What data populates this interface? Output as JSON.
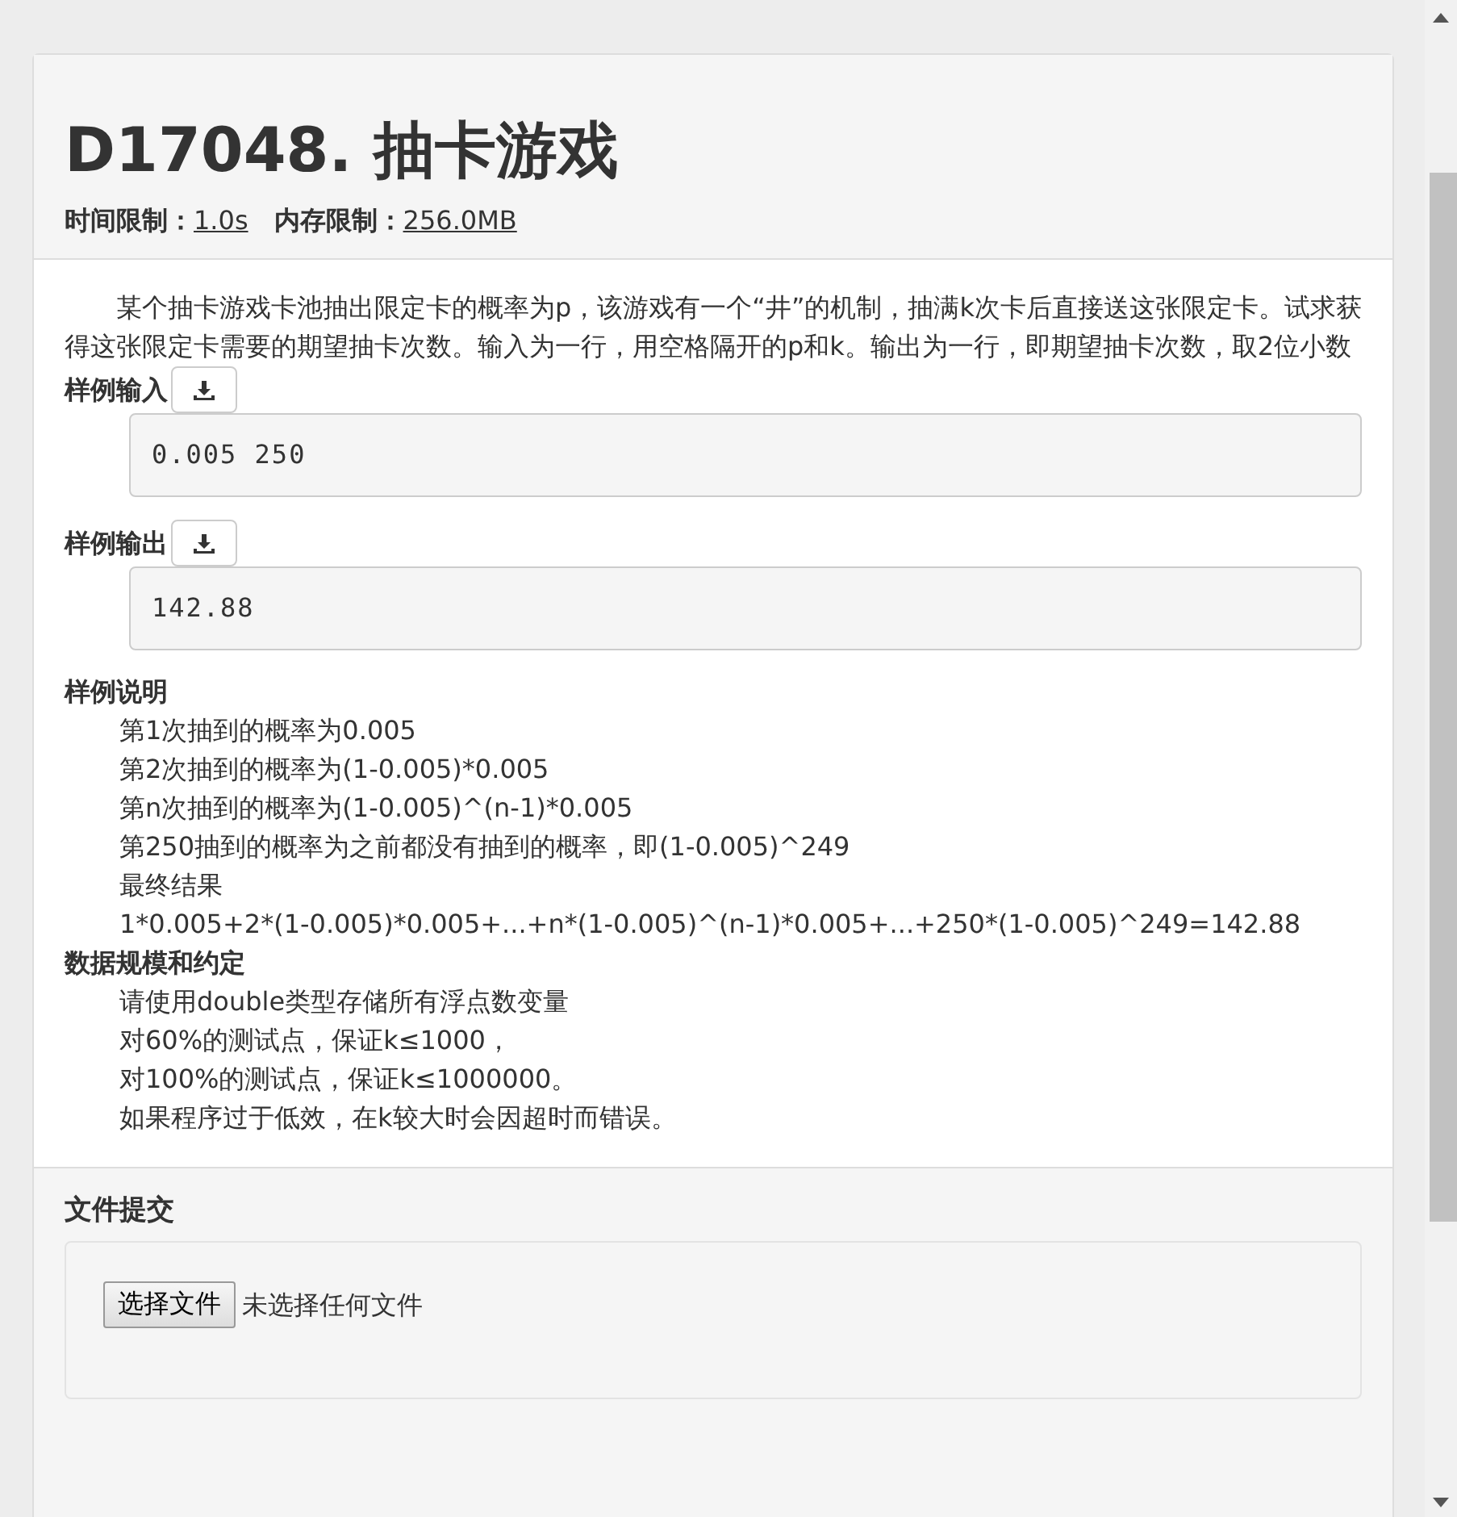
{
  "problem": {
    "title": "D17048. 抽卡游戏",
    "limits": [
      {
        "label": "时间限制：",
        "value": "1.0s"
      },
      {
        "label": "内存限制：",
        "value": "256.0MB"
      }
    ]
  },
  "description": "某个抽卡游戏卡池抽出限定卡的概率为p，该游戏有一个“井”的机制，抽满k次卡后直接送这张限定卡。试求获得这张限定卡需要的期望抽卡次数。输入为一行，用空格隔开的p和k。输出为一行，即期望抽卡次数，取2位小数",
  "samples": [
    {
      "label": "样例输入",
      "content": "0.005 250"
    },
    {
      "label": "样例输出",
      "content": "142.88"
    }
  ],
  "explanation": {
    "heading": "样例说明",
    "lines": [
      "第1次抽到的概率为0.005",
      "第2次抽到的概率为(1-0.005)*0.005",
      "第n次抽到的概率为(1-0.005)^(n-1)*0.005",
      "第250抽到的概率为之前都没有抽到的概率，即(1-0.005)^249",
      "最终结果",
      "1*0.005+2*(1-0.005)*0.005+...+n*(1-0.005)^(n-1)*0.005+...+250*(1-0.005)^249=142.88"
    ]
  },
  "constraints": {
    "heading": "数据规模和约定",
    "lines": [
      "请使用double类型存储所有浮点数变量",
      "对60%的测试点，保证k≤1000，",
      "对100%的测试点，保证k≤1000000。",
      "如果程序过于低效，在k较大时会因超时而错误。"
    ]
  },
  "submit": {
    "heading": "文件提交",
    "button": "选择文件",
    "status": "未选择任何文件"
  }
}
